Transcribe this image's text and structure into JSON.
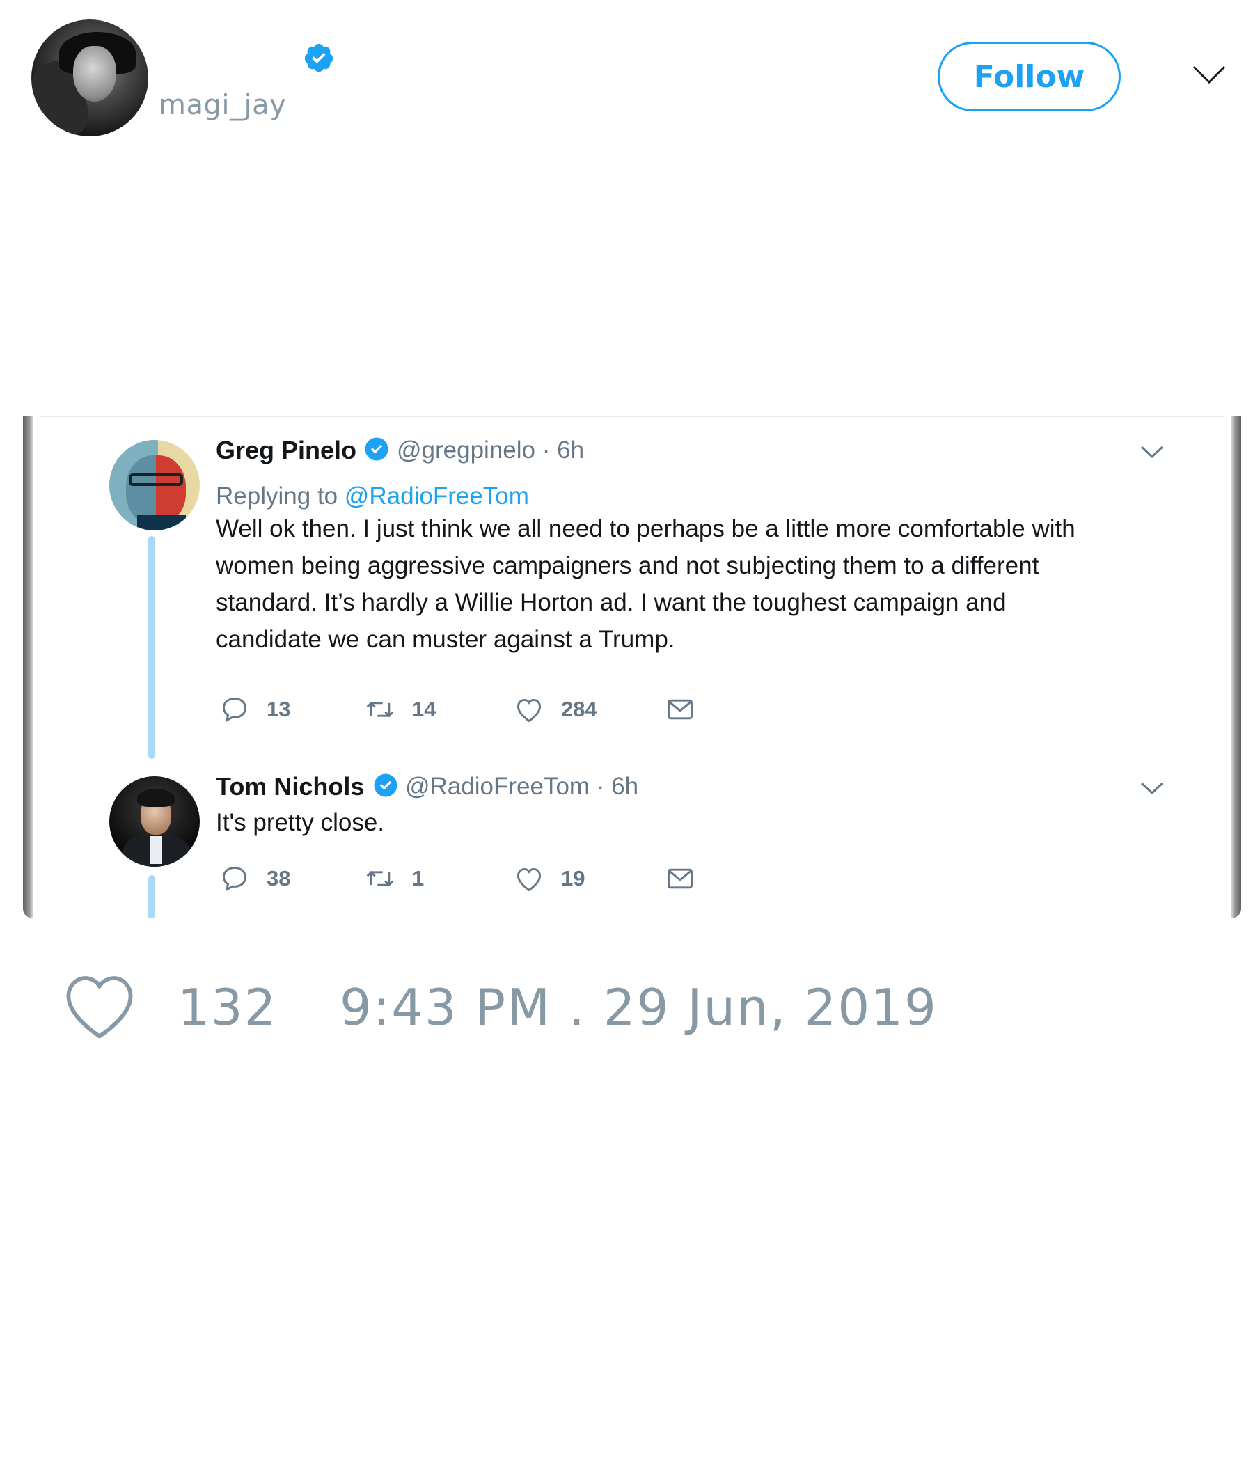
{
  "header": {
    "handle": "magi_jay",
    "follow_label": "Follow"
  },
  "embedded_thread": {
    "tweets": [
      {
        "name": "Greg Pinelo",
        "handle": "@gregpinelo",
        "time": "6h",
        "replying_to_label": "Replying to",
        "replying_to_handle": "@RadioFreeTom",
        "text_lines": [
          "Well ok then. I just think we all need to perhaps be a little more comfortable with",
          "women being aggressive campaigners and not subjecting them to a different",
          "standard. It’s hardly a Willie Horton ad. I want the toughest campaign and",
          "candidate we can muster against a Trump."
        ],
        "replies": "13",
        "retweets": "14",
        "likes": "284"
      },
      {
        "name": "Tom Nichols",
        "handle": "@RadioFreeTom",
        "time": "6h",
        "text_lines": [
          "It's pretty close."
        ],
        "replies": "38",
        "retweets": "1",
        "likes": "19"
      }
    ]
  },
  "footer": {
    "like_count": "132",
    "timestamp": "9:43 PM . 29 Jun, 2019"
  },
  "colors": {
    "accent": "#1da1f2",
    "muted": "#8899a6",
    "text": "#14171a",
    "secondary": "#657786",
    "thread_line": "#aad8f7"
  },
  "icons": [
    "verified-badge-icon",
    "chevron-down-icon",
    "reply-icon",
    "retweet-icon",
    "heart-icon",
    "mail-icon"
  ]
}
